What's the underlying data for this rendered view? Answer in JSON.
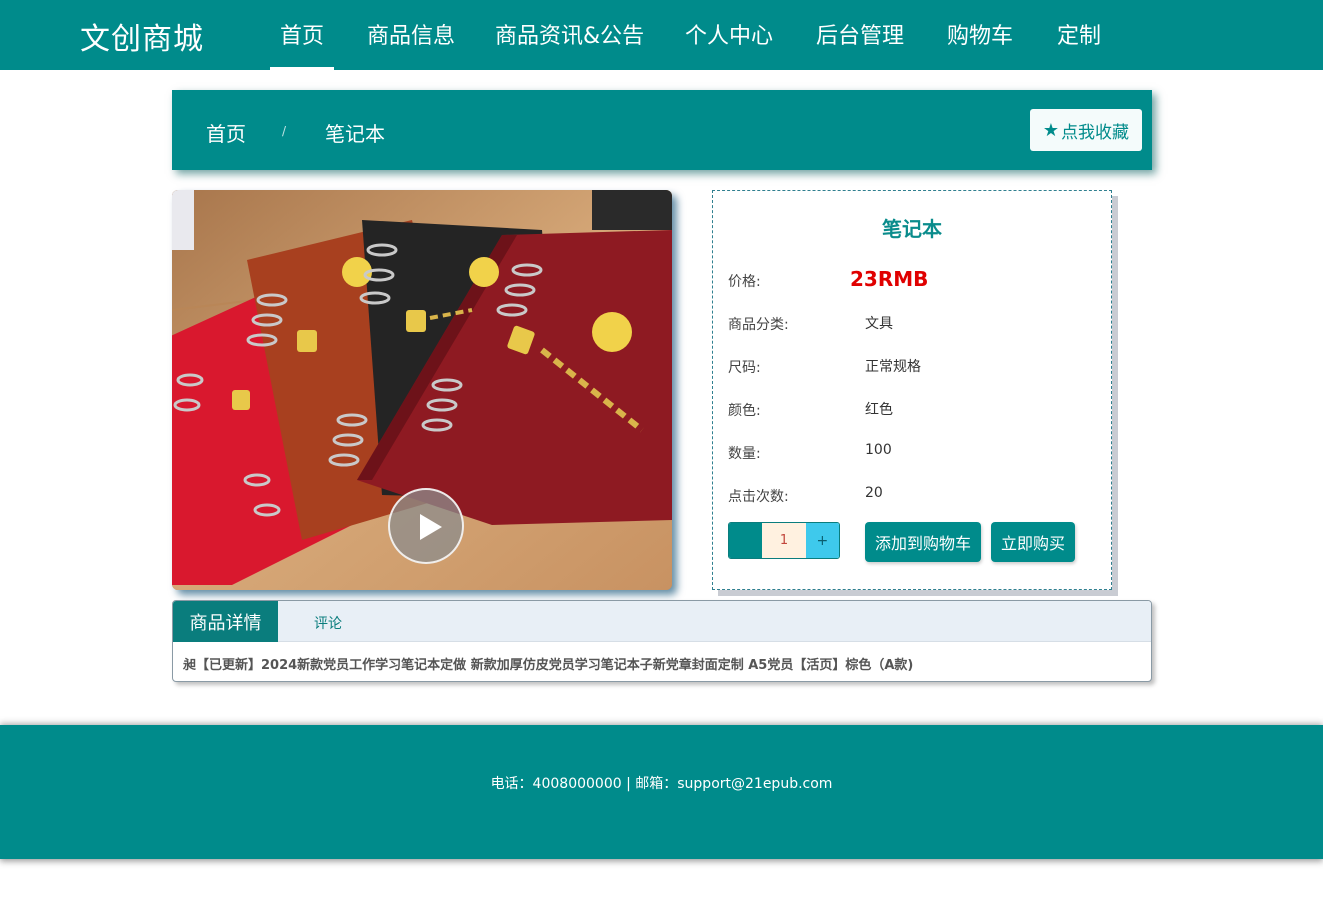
{
  "nav": {
    "brand": "文创商城",
    "items": [
      {
        "label": "首页"
      },
      {
        "label": "商品信息"
      },
      {
        "label": "商品资讯&公告"
      },
      {
        "label": "个人中心"
      },
      {
        "label": "后台管理"
      },
      {
        "label": "购物车"
      },
      {
        "label": "定制"
      }
    ]
  },
  "breadcrumb": {
    "home": "首页",
    "separator": "/",
    "current": "笔记本",
    "favorite_label": "点我收藏",
    "favorite_icon": "star-icon"
  },
  "product": {
    "name": "笔记本",
    "fields": [
      {
        "label": "价格:",
        "value": "23RMB"
      },
      {
        "label": "商品分类:",
        "value": "文具"
      },
      {
        "label": "尺码:",
        "value": "正常规格"
      },
      {
        "label": "颜色:",
        "value": "红色"
      },
      {
        "label": "数量:",
        "value": "100"
      },
      {
        "label": "点击次数:",
        "value": "20"
      }
    ],
    "quantity": "1",
    "plus_label": "+",
    "add_to_cart_label": "添加到购物车",
    "buy_now_label": "立即购买",
    "price_color": "#e00000"
  },
  "detail": {
    "tab_active": "商品详情",
    "tab_comments": "评论",
    "text": "昶【已更新】2024新款党员工作学习笔记本定做 新款加厚仿皮党员学习笔记本子新党章封面定制 A5党员【活页】棕色（A款)"
  },
  "footer": {
    "text": "电话：4008000000 | 邮箱：support@21epub.com"
  },
  "colors": {
    "primary": "#008b8b",
    "price": "#e00000",
    "plus_button": "#3ec9ec"
  }
}
